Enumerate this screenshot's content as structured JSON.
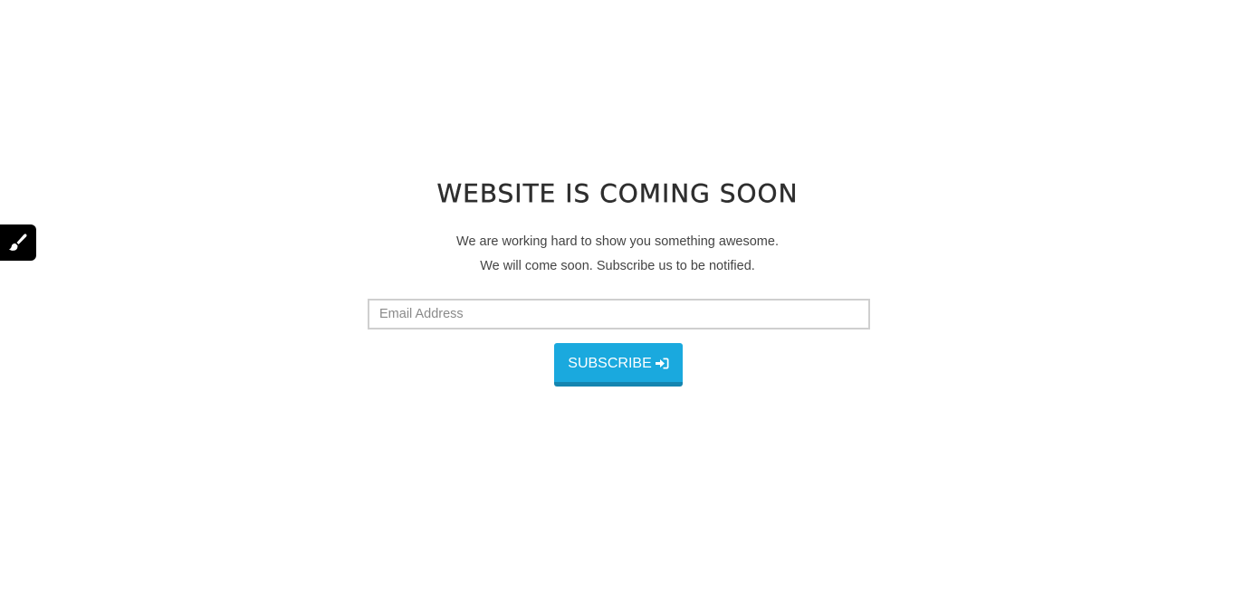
{
  "page": {
    "heading": "WEBSITE IS COMING SOON",
    "subtext_line1": "We are working hard to show you something awesome.",
    "subtext_line2": "We will come soon. Subscribe us to be notified."
  },
  "form": {
    "email_placeholder": "Email Address",
    "email_value": "",
    "subscribe_label": "SUBSCRIBE",
    "subscribe_icon": "sign-in-icon"
  },
  "customizer": {
    "icon": "paint-brush-icon"
  },
  "colors": {
    "accent": "#1aa9de",
    "accent_dark": "#1585b0",
    "heading": "#2e2e2e",
    "text": "#444444",
    "toggle_bg": "#000000"
  }
}
